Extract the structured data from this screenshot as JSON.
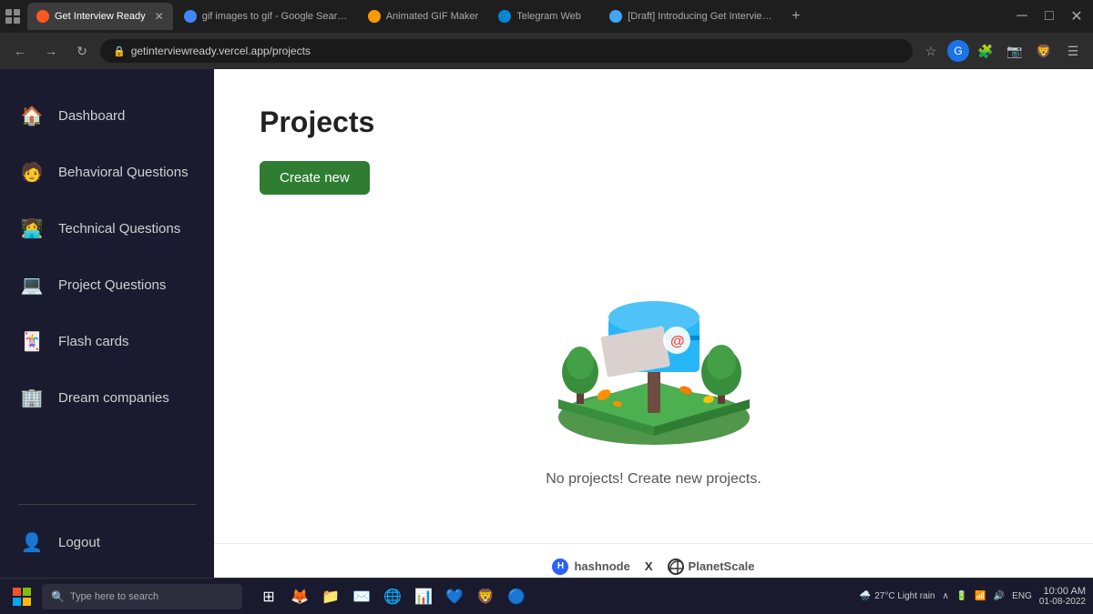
{
  "browser": {
    "tabs": [
      {
        "id": "tab1",
        "title": "Get Interview Ready",
        "favicon_color": "#ff5722",
        "active": true,
        "closable": true
      },
      {
        "id": "tab2",
        "title": "gif images to gif - Google Search",
        "favicon_color": "#4285f4",
        "active": false,
        "closable": false
      },
      {
        "id": "tab3",
        "title": "Animated GIF Maker",
        "favicon_color": "#ff9800",
        "active": false,
        "closable": false
      },
      {
        "id": "tab4",
        "title": "Telegram Web",
        "favicon_color": "#0288d1",
        "active": false,
        "closable": false
      },
      {
        "id": "tab5",
        "title": "[Draft] Introducing Get Interview Rea…",
        "favicon_color": "#42a5f5",
        "active": false,
        "closable": false
      }
    ],
    "address": "getinterviewready.vercel.app/projects",
    "new_tab_symbol": "+",
    "minimize": "─",
    "maximize": "□",
    "close": "✕"
  },
  "sidebar": {
    "items": [
      {
        "id": "dashboard",
        "label": "Dashboard",
        "icon": "🏠"
      },
      {
        "id": "behavioral",
        "label": "Behavioral Questions",
        "icon": "🧑"
      },
      {
        "id": "technical",
        "label": "Technical Questions",
        "icon": "👩‍💻"
      },
      {
        "id": "project",
        "label": "Project Questions",
        "icon": "💻"
      },
      {
        "id": "flashcards",
        "label": "Flash cards",
        "icon": "🃏"
      },
      {
        "id": "dream",
        "label": "Dream companies",
        "icon": "🏢"
      }
    ],
    "logout": {
      "label": "Logout",
      "icon": "👤"
    }
  },
  "main": {
    "title": "Projects",
    "create_button": "Create new",
    "empty_text": "No projects! Create new projects."
  },
  "footer": {
    "hashnode": "hashnode",
    "separator": "X",
    "planetscale": "PlanetScale"
  },
  "taskbar": {
    "search_placeholder": "Type here to search",
    "weather": "27°C  Light rain",
    "time": "10:00 AM",
    "date": "01-08-2022",
    "lang": "ENG"
  }
}
